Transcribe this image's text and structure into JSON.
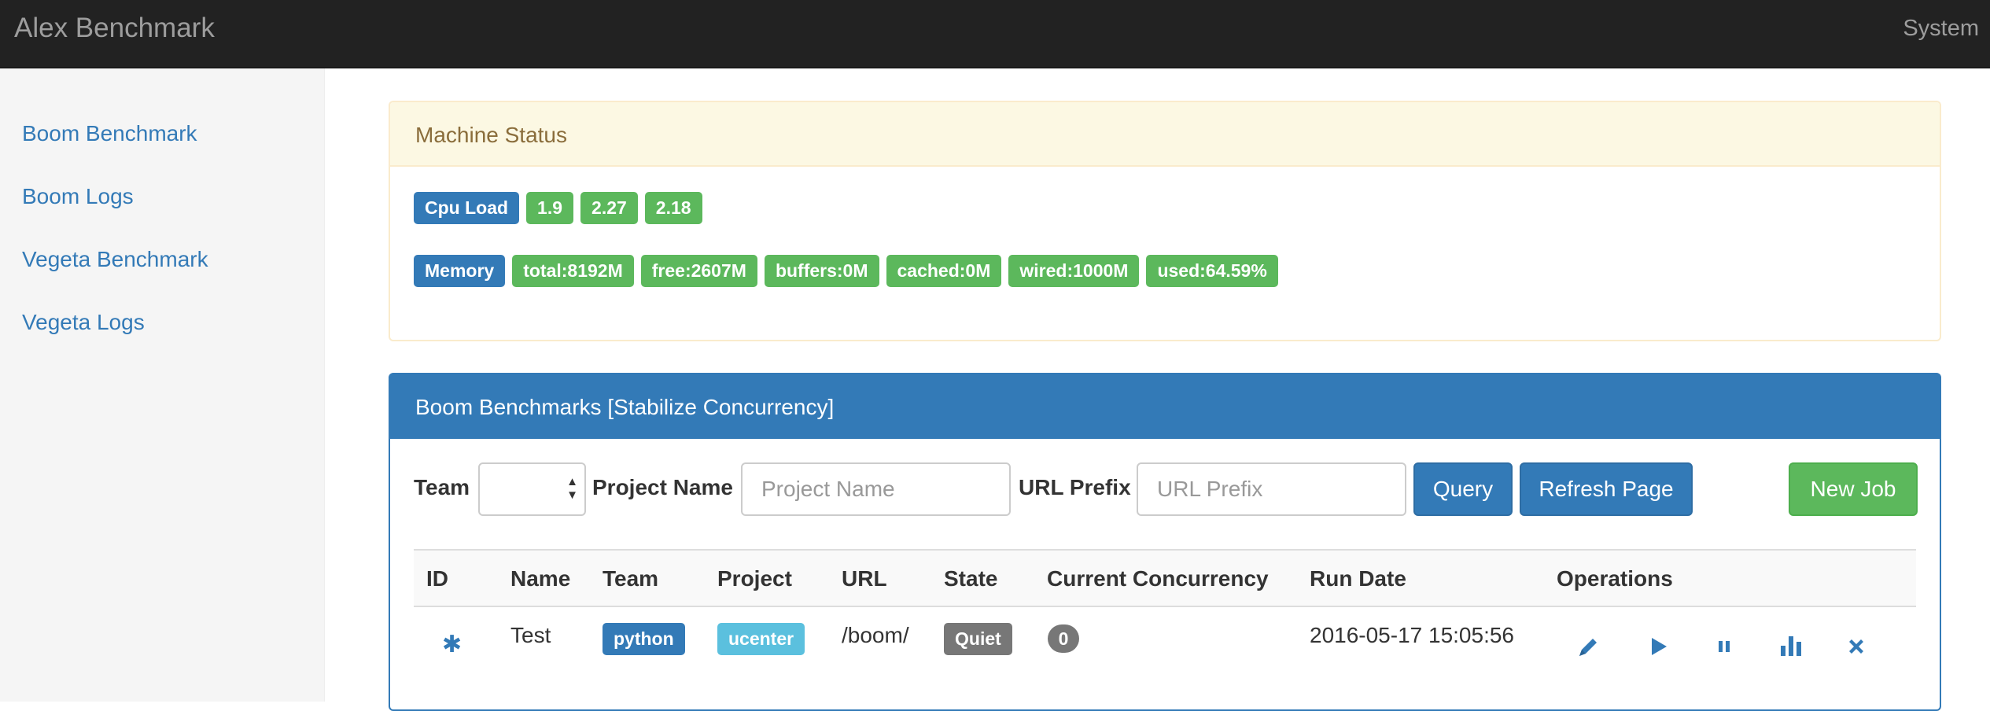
{
  "navbar": {
    "brand": "Alex Benchmark",
    "right_item": "System"
  },
  "sidebar": {
    "items": [
      {
        "label": "Boom Benchmark"
      },
      {
        "label": "Boom Logs"
      },
      {
        "label": "Vegeta Benchmark"
      },
      {
        "label": "Vegeta Logs"
      }
    ]
  },
  "machine_status": {
    "title": "Machine Status",
    "cpu": {
      "label": "Cpu Load",
      "values": [
        "1.9",
        "2.27",
        "2.18"
      ]
    },
    "memory": {
      "label": "Memory",
      "values": [
        "total:8192M",
        "free:2607M",
        "buffers:0M",
        "cached:0M",
        "wired:1000M",
        "used:64.59%"
      ]
    }
  },
  "benchmarks": {
    "title": "Boom Benchmarks [Stabilize Concurrency]",
    "filters": {
      "team_label": "Team",
      "team_value": "",
      "project_label": "Project Name",
      "project_placeholder": "Project Name",
      "project_value": "",
      "url_label": "URL Prefix",
      "url_placeholder": "URL Prefix",
      "url_value": ""
    },
    "buttons": {
      "query": "Query",
      "refresh": "Refresh Page",
      "new_job": "New Job"
    },
    "columns": [
      "ID",
      "Name",
      "Team",
      "Project",
      "URL",
      "State",
      "Current Concurrency",
      "Run Date",
      "Operations"
    ],
    "rows": [
      {
        "id_icon": "asterisk-icon",
        "name": "Test",
        "team": "python",
        "project": "ucenter",
        "url": "/boom/",
        "state": "Quiet",
        "concurrency": "0",
        "run_date": "2016-05-17 15:05:56",
        "operations": [
          "pencil-icon",
          "play-icon",
          "pause-icon",
          "stats-icon",
          "remove-icon"
        ]
      }
    ]
  },
  "colors": {
    "primary": "#337ab7",
    "success": "#5cb85c",
    "info": "#5bc0de",
    "default": "#777777",
    "warning_bg": "#fcf8e3",
    "navbar": "#222222"
  }
}
